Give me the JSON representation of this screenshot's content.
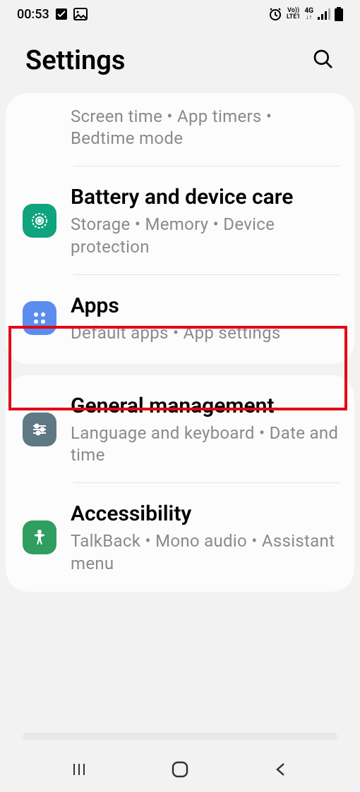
{
  "status": {
    "time": "00:53",
    "volte": "Vo))",
    "lte": "LTE1",
    "network": "4G"
  },
  "header": {
    "title": "Settings"
  },
  "cards": [
    {
      "items": [
        {
          "title": "",
          "subtitle": "Screen time  •  App timers  •  Bedtime mode"
        },
        {
          "title": "Battery and device care",
          "subtitle": "Storage  •  Memory  •  Device protection",
          "icon": "device-care",
          "iconColor": "#0fa37e"
        },
        {
          "title": "Apps",
          "subtitle": "Default apps  •  App settings",
          "icon": "apps",
          "iconColor": "#5b8def",
          "highlighted": true
        }
      ]
    },
    {
      "items": [
        {
          "title": "General management",
          "subtitle": "Language and keyboard  •  Date and time",
          "icon": "general",
          "iconColor": "#5e7884"
        },
        {
          "title": "Accessibility",
          "subtitle": "TalkBack  •  Mono audio  •  Assistant menu",
          "icon": "accessibility",
          "iconColor": "#2f9e5e"
        }
      ]
    }
  ]
}
